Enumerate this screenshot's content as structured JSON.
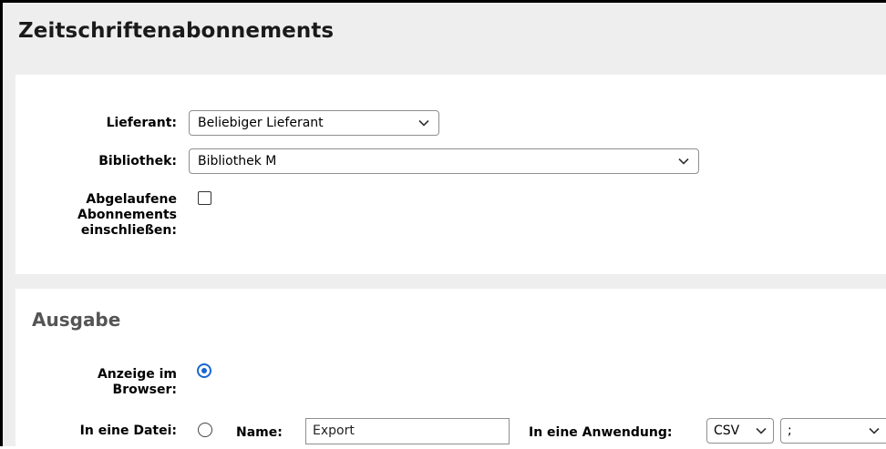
{
  "page": {
    "title": "Zeitschriftenabonnements"
  },
  "filters": {
    "vendor_label": "Lieferant:",
    "vendor_value": "Beliebiger Lieferant",
    "library_label": "Bibliothek:",
    "library_value": "Bibliothek M",
    "expired_label_line1": "Abgelaufene",
    "expired_label_line2": "Abonnements",
    "expired_label_line3": "einschließen:",
    "expired_checked": false
  },
  "output": {
    "section_title": "Ausgabe",
    "browser_label_line1": "Anzeige im",
    "browser_label_line2": "Browser:",
    "browser_selected": true,
    "file_label": "In eine Datei:",
    "file_selected": false,
    "name_label": "Name:",
    "name_value": "Export",
    "app_label": "In eine Anwendung:",
    "format_value": "CSV",
    "delimiter_value": ";"
  },
  "icons": {
    "dropdown": "chevron-down-icon"
  },
  "colors": {
    "accent": "#1a66d1",
    "background": "#eeeeee",
    "panel": "#ffffff"
  }
}
